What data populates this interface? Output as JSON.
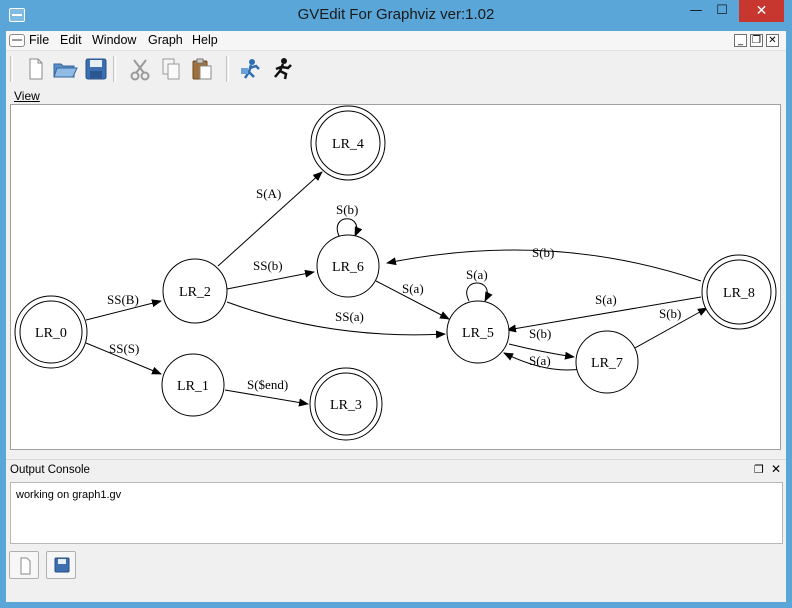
{
  "window": {
    "title": "GVEdit For Graphviz ver:1.02",
    "minimize_glyph": "—",
    "maximize_glyph": "☐",
    "close_glyph": "✕"
  },
  "menubar": {
    "items": [
      "File",
      "Edit",
      "Window",
      "Graph",
      "Help"
    ],
    "mdi_minimize_glyph": "_",
    "mdi_restore_glyph": "❐",
    "mdi_close_glyph": "✕"
  },
  "toolbar": {
    "buttons": [
      "new-file-icon",
      "open-folder-icon",
      "save-icon",
      "cut-icon",
      "copy-icon",
      "paste-icon",
      "layout-icon",
      "run-icon"
    ]
  },
  "view": {
    "label": "View"
  },
  "graph": {
    "nodes": [
      {
        "id": "LR_0",
        "label": "LR_0",
        "accept": true
      },
      {
        "id": "LR_1",
        "label": "LR_1",
        "accept": false
      },
      {
        "id": "LR_2",
        "label": "LR_2",
        "accept": false
      },
      {
        "id": "LR_3",
        "label": "LR_3",
        "accept": true
      },
      {
        "id": "LR_4",
        "label": "LR_4",
        "accept": true
      },
      {
        "id": "LR_5",
        "label": "LR_5",
        "accept": false
      },
      {
        "id": "LR_6",
        "label": "LR_6",
        "accept": false
      },
      {
        "id": "LR_7",
        "label": "LR_7",
        "accept": false
      },
      {
        "id": "LR_8",
        "label": "LR_8",
        "accept": true
      }
    ],
    "edges": [
      {
        "from": "LR_0",
        "to": "LR_2",
        "label": "SS(B)"
      },
      {
        "from": "LR_0",
        "to": "LR_1",
        "label": "SS(S)"
      },
      {
        "from": "LR_1",
        "to": "LR_3",
        "label": "S($end)"
      },
      {
        "from": "LR_2",
        "to": "LR_6",
        "label": "SS(b)"
      },
      {
        "from": "LR_2",
        "to": "LR_5",
        "label": "SS(a)"
      },
      {
        "from": "LR_2",
        "to": "LR_4",
        "label": "S(A)"
      },
      {
        "from": "LR_5",
        "to": "LR_7",
        "label": "S(b)"
      },
      {
        "from": "LR_5",
        "to": "LR_5",
        "label": "S(a)"
      },
      {
        "from": "LR_6",
        "to": "LR_6",
        "label": "S(b)"
      },
      {
        "from": "LR_6",
        "to": "LR_5",
        "label": "S(a)"
      },
      {
        "from": "LR_7",
        "to": "LR_8",
        "label": "S(b)"
      },
      {
        "from": "LR_7",
        "to": "LR_5",
        "label": "S(a)"
      },
      {
        "from": "LR_8",
        "to": "LR_6",
        "label": "S(b)"
      },
      {
        "from": "LR_8",
        "to": "LR_5",
        "label": "S(a)"
      }
    ]
  },
  "console": {
    "title": "Output Console",
    "float_glyph": "❐",
    "close_glyph": "✕",
    "text": "working on graph1.gv",
    "buttons": [
      "clear-console-icon",
      "save-console-icon"
    ]
  }
}
